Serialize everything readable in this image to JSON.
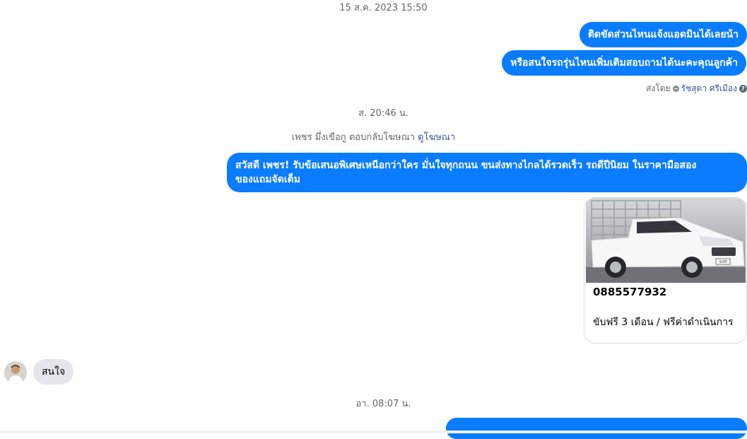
{
  "timestamps": {
    "first": "15 ส.ค. 2023 15:50",
    "second": "ส. 20:46 น.",
    "third": "อา. 08:07 น."
  },
  "outgoing": [
    "ติดขัดส่วนไหนแจ้งแอดมินได้เลยน้า",
    "หรือสนใจรถรุ่นไหนเพิ่มเติมสอบถามได้นะคะคุณลูกค้า"
  ],
  "sent_by": {
    "prefix": "ส่งโดย",
    "name": "รัชสุดา ศรีเมือง",
    "help_glyph": "?"
  },
  "ad_reply": {
    "text": "เพชร มึ่งเขือกู ตอบกลับโฆษณา",
    "link": "ดูโฆษณา"
  },
  "ad_message": {
    "line1": "สวัสดี เพชร! รับข้อเสนอพิเศษเหนือกว่าใคร  มั่นใจทุกถนน ขนส่งทางไกลได้รวดเร็ว รถดีปีนิยม ในราคามือสอง",
    "line2": "ของแถมจัดเต็ม"
  },
  "ad_card": {
    "title": "0885577932",
    "description": "ขับฟรี 3 เดือน / ฟรีค่าดำเนินการ",
    "plate_text": "SUM"
  },
  "incoming": {
    "text": "สนใจ"
  },
  "colors": {
    "outgoing_bubble": "#0a7cff",
    "incoming_bubble": "#e4e6eb",
    "timestamp": "#65676b",
    "link": "#385898"
  }
}
